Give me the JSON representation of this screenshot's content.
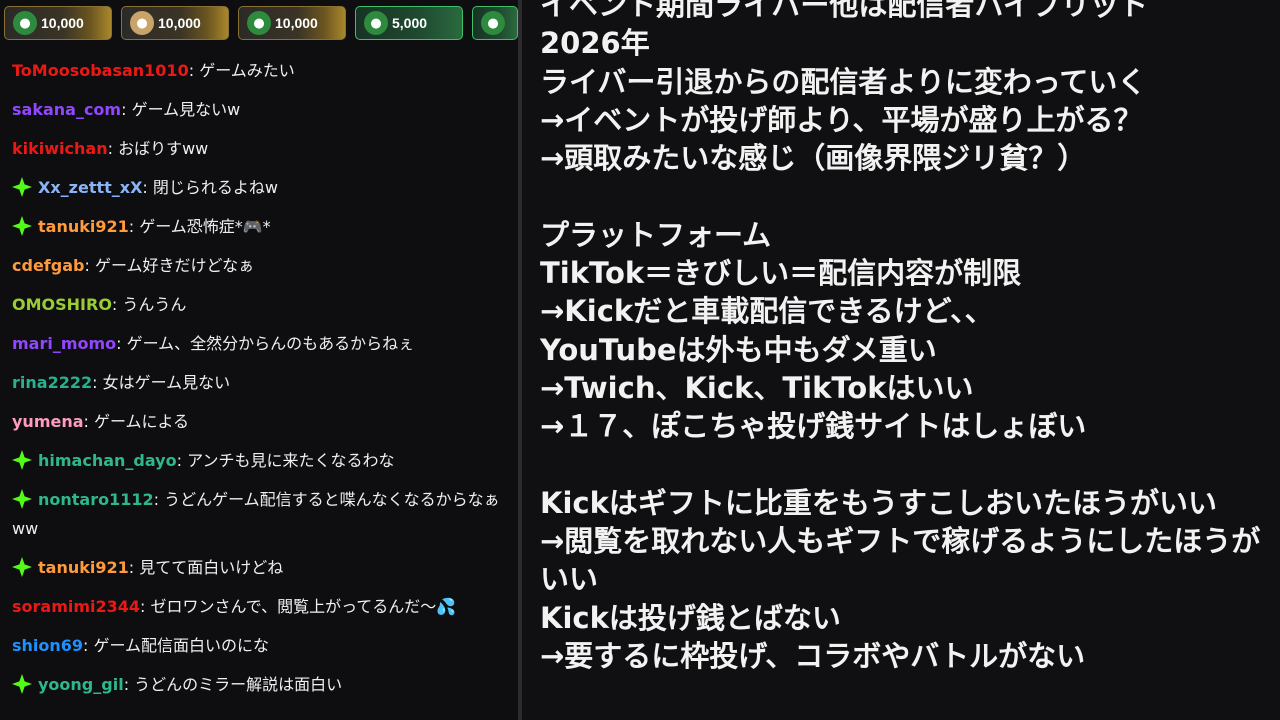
{
  "gifts": [
    {
      "amount": "10,000",
      "style": "gold",
      "avatar_icon": "leaf-avatar-icon",
      "avatar_color": "#2e8b3e"
    },
    {
      "amount": "10,000",
      "style": "gold",
      "avatar_icon": "face-avatar-icon",
      "avatar_color": "#c9a36a"
    },
    {
      "amount": "10,000",
      "style": "gold",
      "avatar_icon": "leaf-avatar-icon",
      "avatar_color": "#2e8b3e"
    },
    {
      "amount": "5,000",
      "style": "green",
      "avatar_icon": "leaf-avatar-icon",
      "avatar_color": "#2e8b3e"
    },
    {
      "amount": "",
      "style": "green",
      "avatar_icon": "leaf-avatar-icon",
      "avatar_color": "#2e8b3e"
    }
  ],
  "chat": [
    {
      "user": "ToMoosobasan1010",
      "color": "#e91916",
      "badge": false,
      "text": "ゲームみたい"
    },
    {
      "user": "sakana_com",
      "color": "#9146ff",
      "badge": false,
      "text": "ゲーム見ないw"
    },
    {
      "user": "kikiwichan",
      "color": "#e91916",
      "badge": false,
      "text": "おばりすww"
    },
    {
      "user": "Xx_zettt_xX",
      "color": "#8ab4f8",
      "badge": true,
      "text": "閉じられるよねw"
    },
    {
      "user": "tanuki921",
      "color": "#ff9b3d",
      "badge": true,
      "text": "ゲーム恐怖症*🎮*"
    },
    {
      "user": "cdefgab",
      "color": "#ff9b3d",
      "badge": false,
      "text": "ゲーム好きだけどなぁ"
    },
    {
      "user": "OMOSHIRO",
      "color": "#9acd32",
      "badge": false,
      "text": "うんうん"
    },
    {
      "user": "mari_momo",
      "color": "#9146ff",
      "badge": false,
      "text": "ゲーム、全然分からんのもあるからねぇ"
    },
    {
      "user": "rina2222",
      "color": "#29b08f",
      "badge": false,
      "text": "女はゲーム見ない"
    },
    {
      "user": "yumena",
      "color": "#ff9ac1",
      "badge": false,
      "text": "ゲームによる"
    },
    {
      "user": "himachan_dayo",
      "color": "#2eb88a",
      "badge": true,
      "text": "アンチも見に来たくなるわな"
    },
    {
      "user": "nontaro1112",
      "color": "#2eb88a",
      "badge": true,
      "text": "うどんゲーム配信すると喋んなくなるからなぁww"
    },
    {
      "user": "tanuki921",
      "color": "#ff9b3d",
      "badge": true,
      "text": "見てて面白いけどね"
    },
    {
      "user": "soramimi2344",
      "color": "#e91916",
      "badge": false,
      "text": "ゼロワンさんで、閲覧上がってるんだ〜💦"
    },
    {
      "user": "shion69",
      "color": "#1e90ff",
      "badge": false,
      "text": "ゲーム配信面白いのにな"
    },
    {
      "user": "yoong_gil",
      "color": "#2eb88a",
      "badge": true,
      "text": "うどんのミラー解説は面白い"
    }
  ],
  "notes": [
    "イベント期間ライバー他は配信者ハイブリット",
    "2026年",
    "ライバー引退からの配信者よりに変わっていく",
    "→イベントが投げ師より、平場が盛り上がる？",
    "→頭取みたいな感じ（画像界隈ジリ貧？）",
    "",
    "プラットフォーム",
    "TikTok＝きびしい＝配信内容が制限",
    "→Kickだと車載配信できるけど、、",
    "YouTubeは外も中もダメ重い",
    "→Twich、Kick、TikTokはいい",
    "→１７、ぽこちゃ投げ銭サイトはしょぼい",
    "",
    "Kickはギフトに比重をもうすこしおいたほうがいい",
    "→閲覧を取れない人もギフトで稼げるようにしたほうがいい",
    "Kickは投げ銭とばない",
    "→要するに枠投げ、コラボやバトルがない"
  ],
  "colors": {
    "chat_text": "#efeff1",
    "badge_green": "#53fc18",
    "note_text": "#f2f2f2"
  }
}
